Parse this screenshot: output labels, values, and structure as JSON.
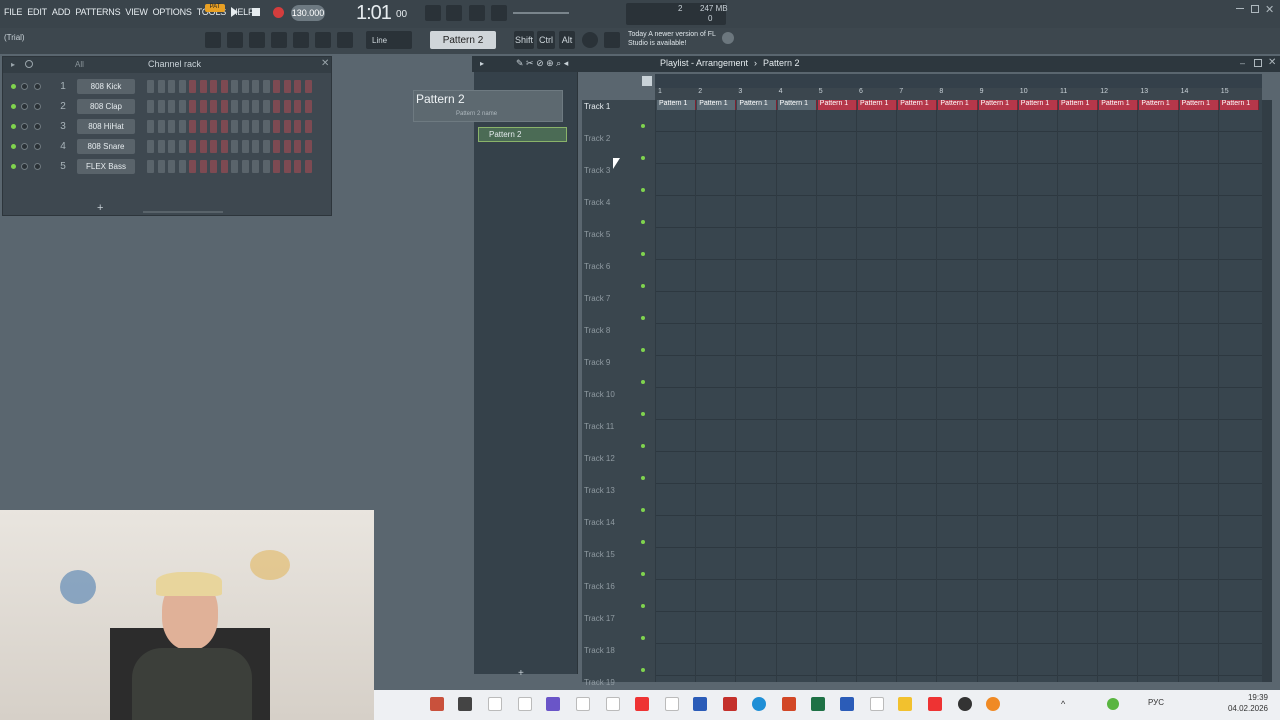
{
  "menu": [
    "FILE",
    "EDIT",
    "ADD",
    "PATTERNS",
    "VIEW",
    "OPTIONS",
    "TOOLS",
    "HELP"
  ],
  "title_trial": "(Trial)",
  "transport": {
    "pat": "PAT",
    "tempo": "130.000",
    "time": "1:01",
    "time_sub": "00",
    "cpu": "2",
    "mem": "247 MB",
    "voices": "0"
  },
  "snap": "Line",
  "pattern_selector": "Pattern 2",
  "toolbar": {
    "shift": "Shift",
    "ctrl": "Ctrl",
    "alt": "Alt"
  },
  "update_notice": "Today  A newer version of FL Studio is available!",
  "rack": {
    "filter": "All",
    "title": "Channel rack",
    "channels": [
      {
        "num": "1",
        "name": "808 Kick"
      },
      {
        "num": "2",
        "name": "808 Clap"
      },
      {
        "num": "3",
        "name": "808 HiHat"
      },
      {
        "num": "4",
        "name": "808 Snare"
      },
      {
        "num": "5",
        "name": "FLEX Bass"
      }
    ],
    "add_label": "+"
  },
  "rename": {
    "title": "Pattern 2",
    "sub": "Pattern 2 name"
  },
  "picker": {
    "items": [
      "Pattern 2"
    ],
    "add_label": "+"
  },
  "playlist": {
    "title": "Playlist - Arrangement",
    "crumb": "Pattern 2",
    "bars": [
      "1",
      "2",
      "3",
      "4",
      "5",
      "6",
      "7",
      "8",
      "9",
      "10",
      "11",
      "12",
      "13",
      "14",
      "15"
    ],
    "tracks": [
      "Track 1",
      "Track 2",
      "Track 3",
      "Track 4",
      "Track 5",
      "Track 6",
      "Track 7",
      "Track 8",
      "Track 9",
      "Track 10",
      "Track 11",
      "Track 12",
      "Track 13",
      "Track 14",
      "Track 15",
      "Track 16",
      "Track 17",
      "Track 18",
      "Track 19"
    ],
    "clip_label": "Pattern 1",
    "clip_count": 15
  },
  "taskbar": {
    "lang": "РУС",
    "time": "19:39",
    "date": "04.02.2026"
  },
  "colors": {
    "accent": "#7fd34e",
    "clip": "#b5374a",
    "bg": "#5a666f"
  }
}
